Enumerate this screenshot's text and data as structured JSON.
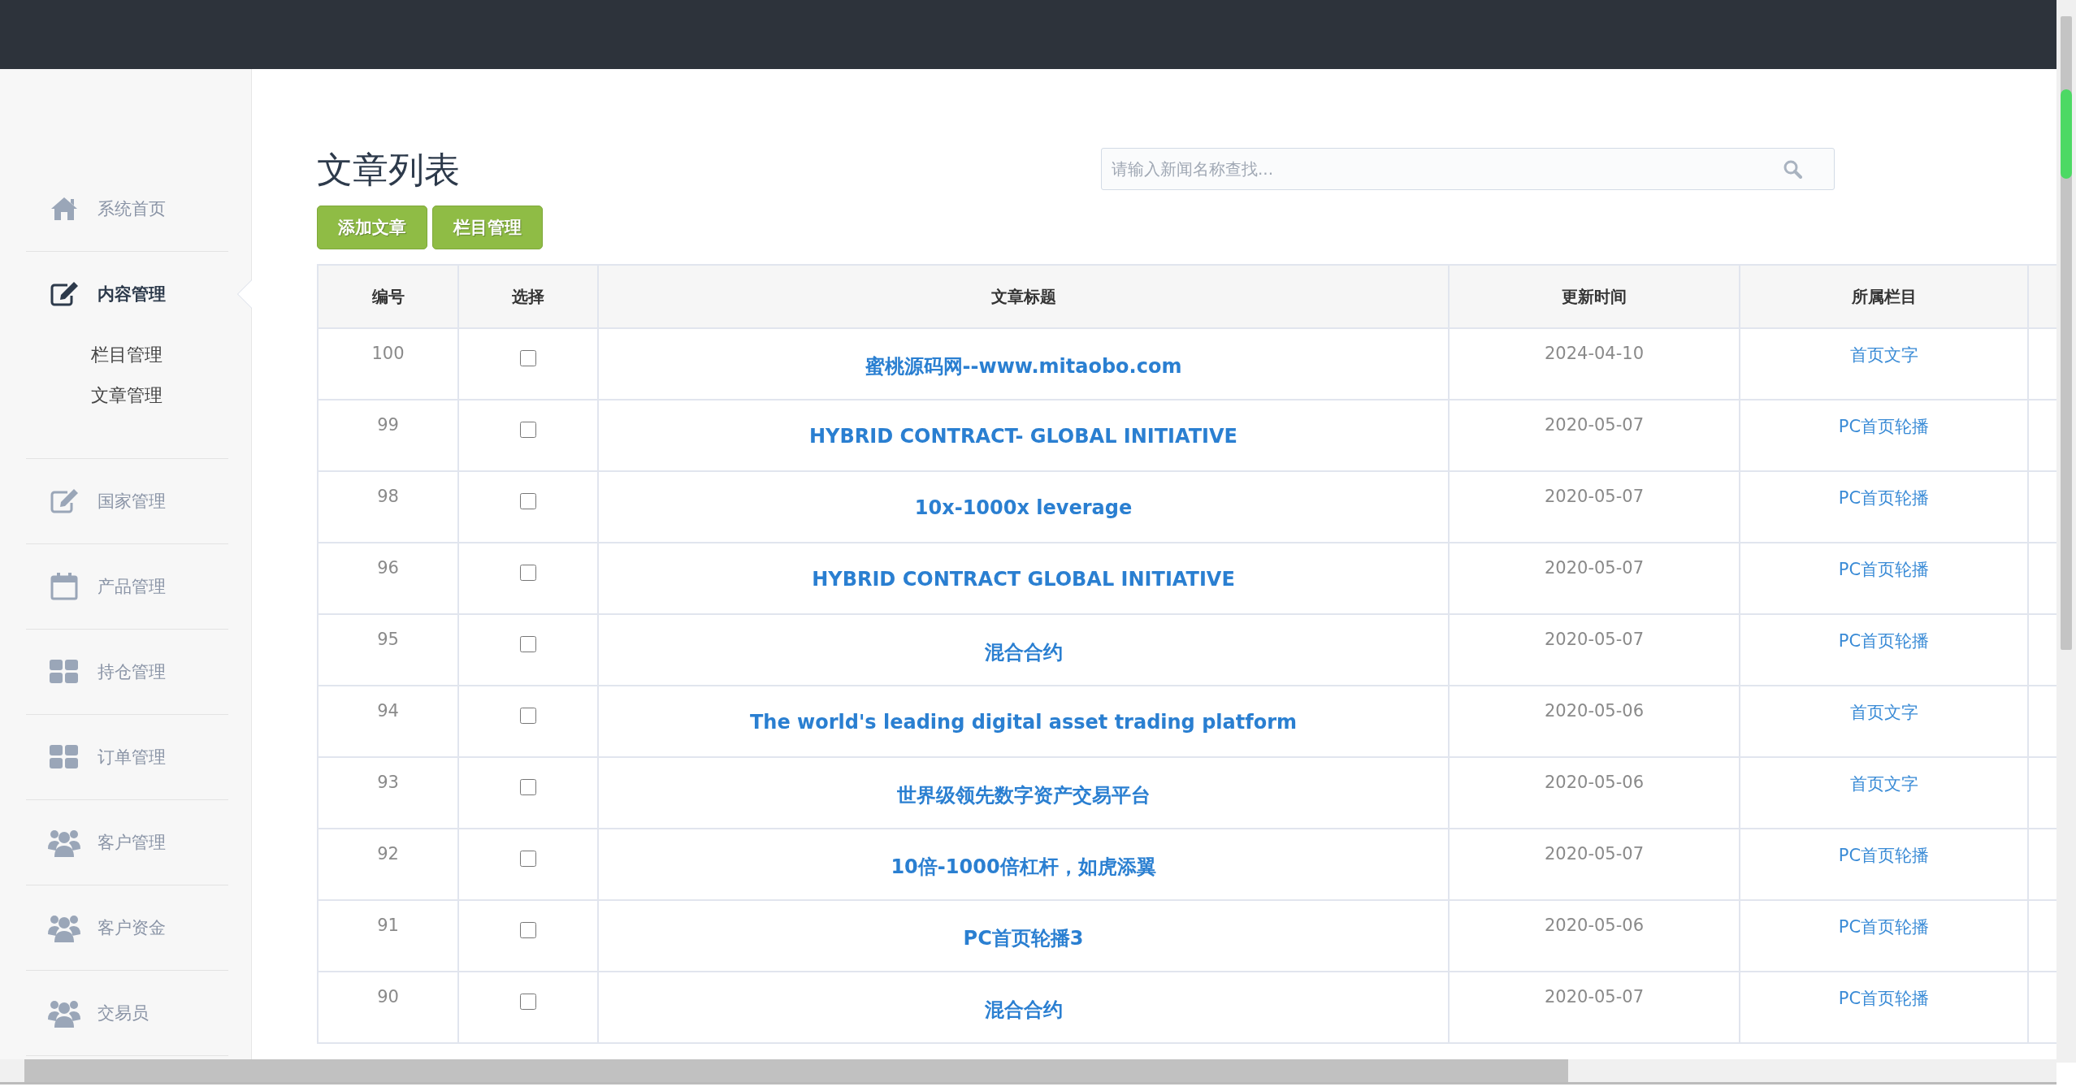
{
  "sidebar": {
    "items": [
      {
        "label": "系统首页",
        "selected": false
      },
      {
        "label": "内容管理",
        "selected": true,
        "expanded": true,
        "children": [
          {
            "label": "栏目管理"
          },
          {
            "label": "文章管理"
          }
        ]
      },
      {
        "label": "国家管理",
        "selected": false
      },
      {
        "label": "产品管理",
        "selected": false
      },
      {
        "label": "持仓管理",
        "selected": false
      },
      {
        "label": "订单管理",
        "selected": false
      },
      {
        "label": "客户管理",
        "selected": false
      },
      {
        "label": "客户资金",
        "selected": false
      },
      {
        "label": "交易员",
        "selected": false
      }
    ]
  },
  "page_title": "文章列表",
  "search": {
    "placeholder": "请输入新闻名称查找..."
  },
  "buttons": [
    "添加文章",
    "栏目管理"
  ],
  "table": {
    "columns": [
      "编号",
      "选择",
      "文章标题",
      "更新时间",
      "所属栏目"
    ],
    "rows": [
      {
        "id": "100",
        "checked": false,
        "title": "蜜桃源码网--www.mitaobo.com",
        "updated": "2024-04-10",
        "category": "首页文字"
      },
      {
        "id": "99",
        "checked": false,
        "title": "HYBRID CONTRACT- GLOBAL INITIATIVE",
        "updated": "2020-05-07",
        "category": "PC首页轮播"
      },
      {
        "id": "98",
        "checked": false,
        "title": "10x-1000x leverage",
        "updated": "2020-05-07",
        "category": "PC首页轮播"
      },
      {
        "id": "96",
        "checked": false,
        "title": "HYBRID CONTRACT GLOBAL INITIATIVE",
        "updated": "2020-05-07",
        "category": "PC首页轮播"
      },
      {
        "id": "95",
        "checked": false,
        "title": "混合合约",
        "updated": "2020-05-07",
        "category": "PC首页轮播"
      },
      {
        "id": "94",
        "checked": false,
        "title": "The world's leading digital asset trading platform",
        "updated": "2020-05-06",
        "category": "首页文字"
      },
      {
        "id": "93",
        "checked": false,
        "title": "世界级领先数字资产交易平台",
        "updated": "2020-05-06",
        "category": "首页文字"
      },
      {
        "id": "92",
        "checked": false,
        "title": "10倍-1000倍杠杆，如虎添翼",
        "updated": "2020-05-07",
        "category": "PC首页轮播"
      },
      {
        "id": "91",
        "checked": false,
        "title": "PC首页轮播3",
        "updated": "2020-05-06",
        "category": "PC首页轮播"
      },
      {
        "id": "90",
        "checked": false,
        "title": "混合合约",
        "updated": "2020-05-07",
        "category": "PC首页轮播"
      }
    ]
  }
}
